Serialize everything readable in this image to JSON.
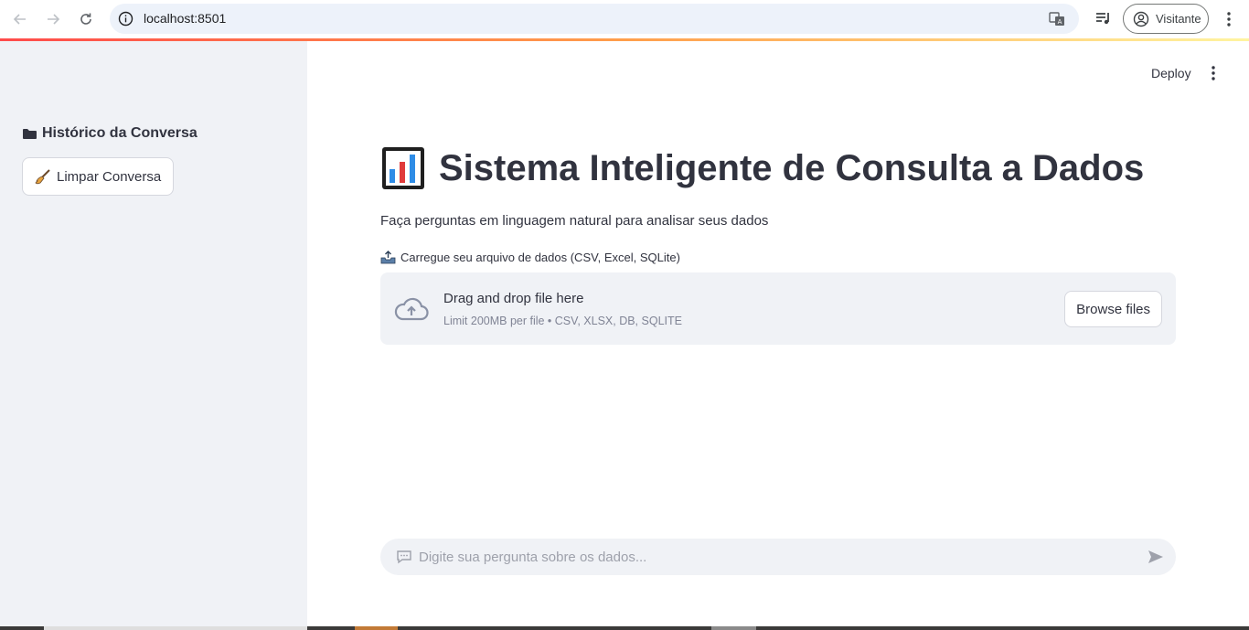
{
  "browser": {
    "url": "localhost:8501",
    "profile_label": "Visitante"
  },
  "sidebar": {
    "title": "Histórico da Conversa",
    "title_icon": "folder-icon",
    "clear_button_label": "Limpar Conversa",
    "clear_button_icon": "broom-icon"
  },
  "header": {
    "deploy_label": "Deploy"
  },
  "main": {
    "title": "Sistema Inteligente de Consulta a Dados",
    "title_icon": "bar-chart-icon",
    "subtitle": "Faça perguntas em linguagem natural para analisar seus dados",
    "upload": {
      "label": "Carregue seu arquivo de dados (CSV, Excel, SQLite)",
      "label_icon": "outbox-tray-icon",
      "drop_title": "Drag and drop file here",
      "limit_text": "Limit 200MB per file • CSV, XLSX, DB, SQLITE",
      "browse_label": "Browse files"
    },
    "chat": {
      "placeholder": "Digite sua pergunta sobre os dados..."
    }
  },
  "colors": {
    "sidebar_bg": "#f0f2f6",
    "text": "#31333f",
    "accent_gradient_start": "#ff4b4b",
    "accent_gradient_end": "#fff4a0"
  }
}
